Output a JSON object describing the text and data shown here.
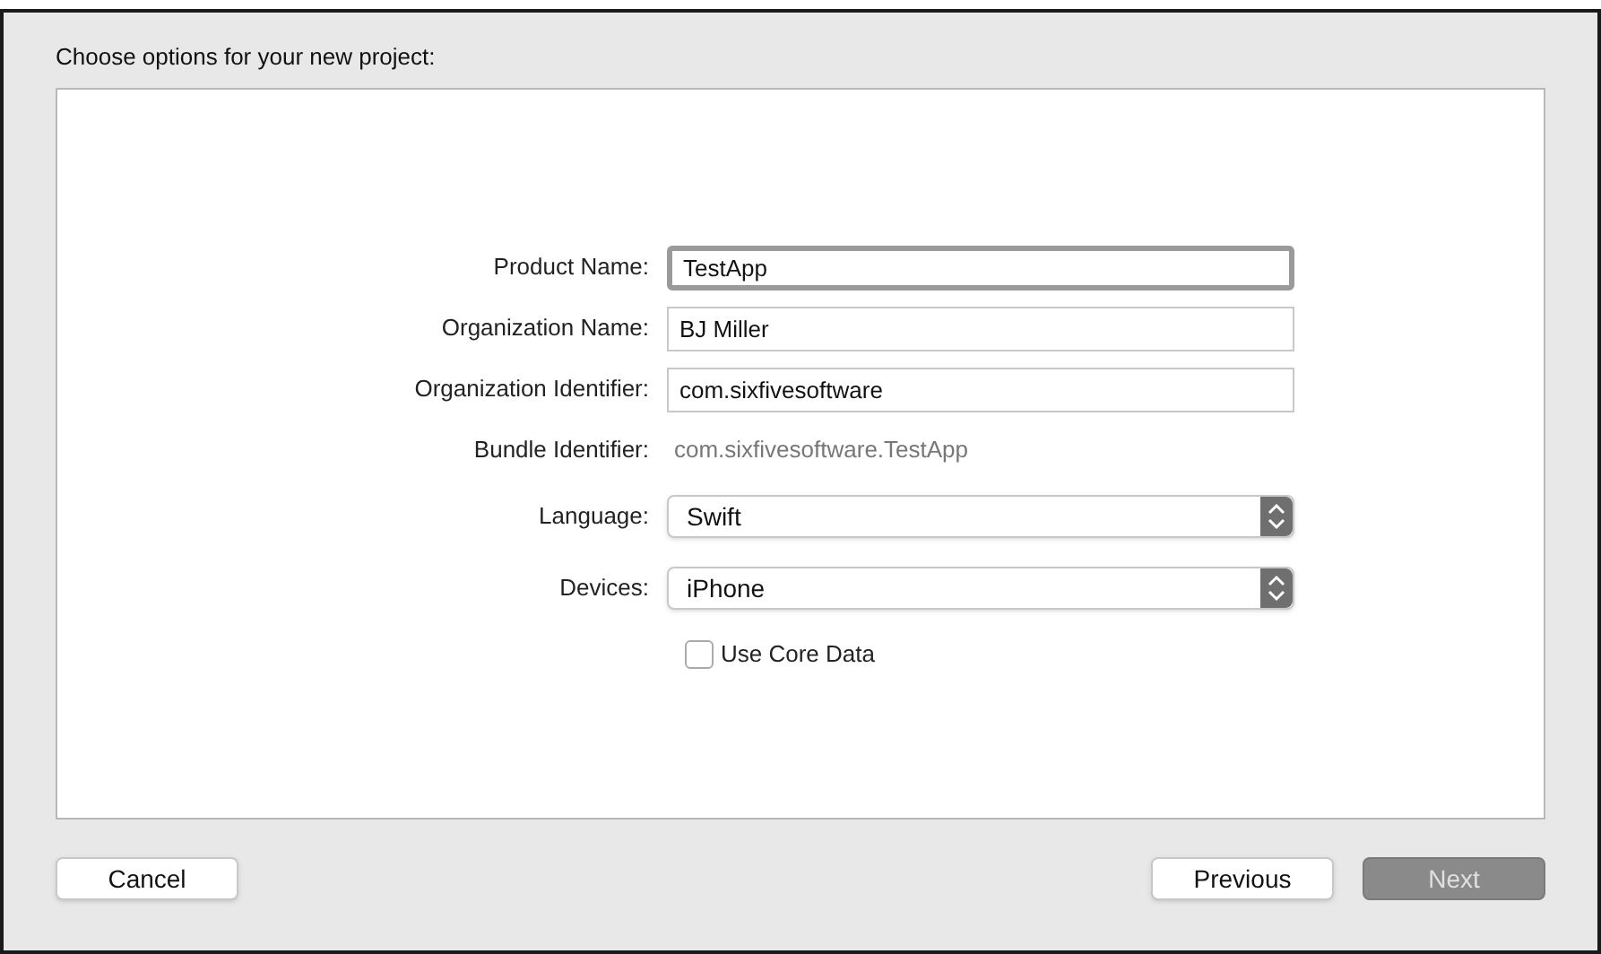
{
  "heading": "Choose options for your new project:",
  "fields": [
    {
      "kind": "text",
      "label": "Product Name:",
      "value": "TestApp",
      "focused": true
    },
    {
      "kind": "text",
      "label": "Organization Name:",
      "value": "BJ Miller",
      "focused": false
    },
    {
      "kind": "text",
      "label": "Organization Identifier:",
      "value": "com.sixfivesoftware",
      "focused": false
    },
    {
      "kind": "static",
      "label": "Bundle Identifier:",
      "value": "com.sixfivesoftware.TestApp"
    },
    {
      "kind": "popup",
      "label": "Language:",
      "value": "Swift"
    },
    {
      "kind": "popup",
      "label": "Devices:",
      "value": "iPhone"
    },
    {
      "kind": "checkbox",
      "label": "Use Core Data",
      "checked": false
    }
  ],
  "buttons": [
    {
      "label": "Cancel",
      "disabled": false
    },
    {
      "label": "Previous",
      "disabled": false
    },
    {
      "label": "Next",
      "disabled": true
    }
  ]
}
